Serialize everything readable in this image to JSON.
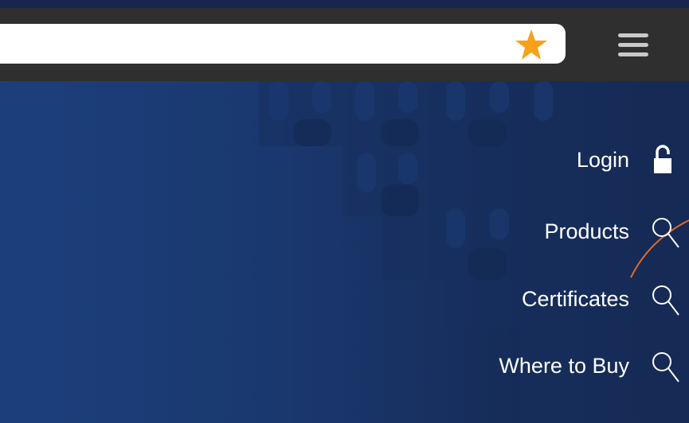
{
  "browser": {
    "address_value": "",
    "bookmark_icon": "star-icon",
    "menu_icon": "hamburger-menu-icon"
  },
  "nav": {
    "items": [
      {
        "label": "Login",
        "icon": "unlocked-lock-icon"
      },
      {
        "label": "Products",
        "icon": "search-icon"
      },
      {
        "label": "Certificates",
        "icon": "search-icon"
      },
      {
        "label": "Where to Buy",
        "icon": "search-icon"
      }
    ]
  },
  "colors": {
    "star": "#f7a11a",
    "accent_curve": "#e06a2a",
    "text": "#ffffff",
    "background": "#1c3f7c",
    "browser_bar": "#2f2f2f"
  }
}
